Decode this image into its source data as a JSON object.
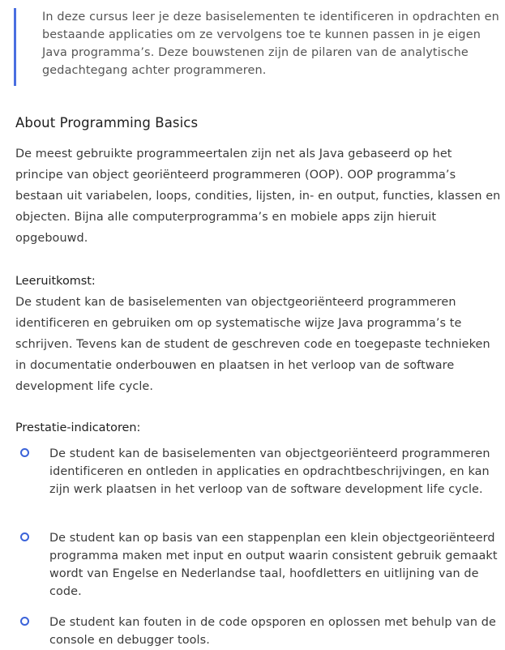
{
  "intro_quote": "In deze cursus leer je deze basiselementen te identificeren in opdrachten en bestaande applicaties om ze vervolgens toe te kunnen passen in je eigen Java programma’s. Deze bouwstenen zijn de pilaren van de analytische gedachtegang achter programmeren.",
  "about": {
    "title": "About Programming Basics",
    "description": "De meest gebruikte programmeertalen zijn net als Java gebaseerd op het principe van object georiënteerd programmeren (OOP). OOP programma’s bestaan uit variabelen, loops, condities, lijsten, in- en output, functies, klassen en objecten. Bijna alle computerprogramma’s en mobiele apps zijn hieruit opgebouwd."
  },
  "learning_outcome": {
    "label": "Leeruitkomst:",
    "text": "De student kan de basiselementen van objectgeoriënteerd programmeren identificeren en gebruiken om op systematische wijze Java programma’s te schrijven. Tevens kan de student de geschreven code en toegepaste technieken in documentatie onderbouwen en plaatsen in het verloop van de software development life cycle."
  },
  "indicators": {
    "label": "Prestatie-indicatoren:",
    "items": [
      "De student kan de basiselementen van objectgeoriënteerd programmeren identificeren en ontleden in applicaties en opdrachtbeschrijvingen, en kan zijn werk plaatsen in het verloop van de software development life cycle.",
      "De student kan op basis van een stappenplan een klein objectgeoriënteerd programma maken met input en output waarin consistent gebruik gemaakt wordt van Engelse en Nederlandse taal, hoofdletters en uitlijning van de code.",
      "De student kan fouten in de code opsporen en oplossen met behulp van de console en debugger tools."
    ]
  },
  "colors": {
    "accent": "#3b63d9"
  }
}
